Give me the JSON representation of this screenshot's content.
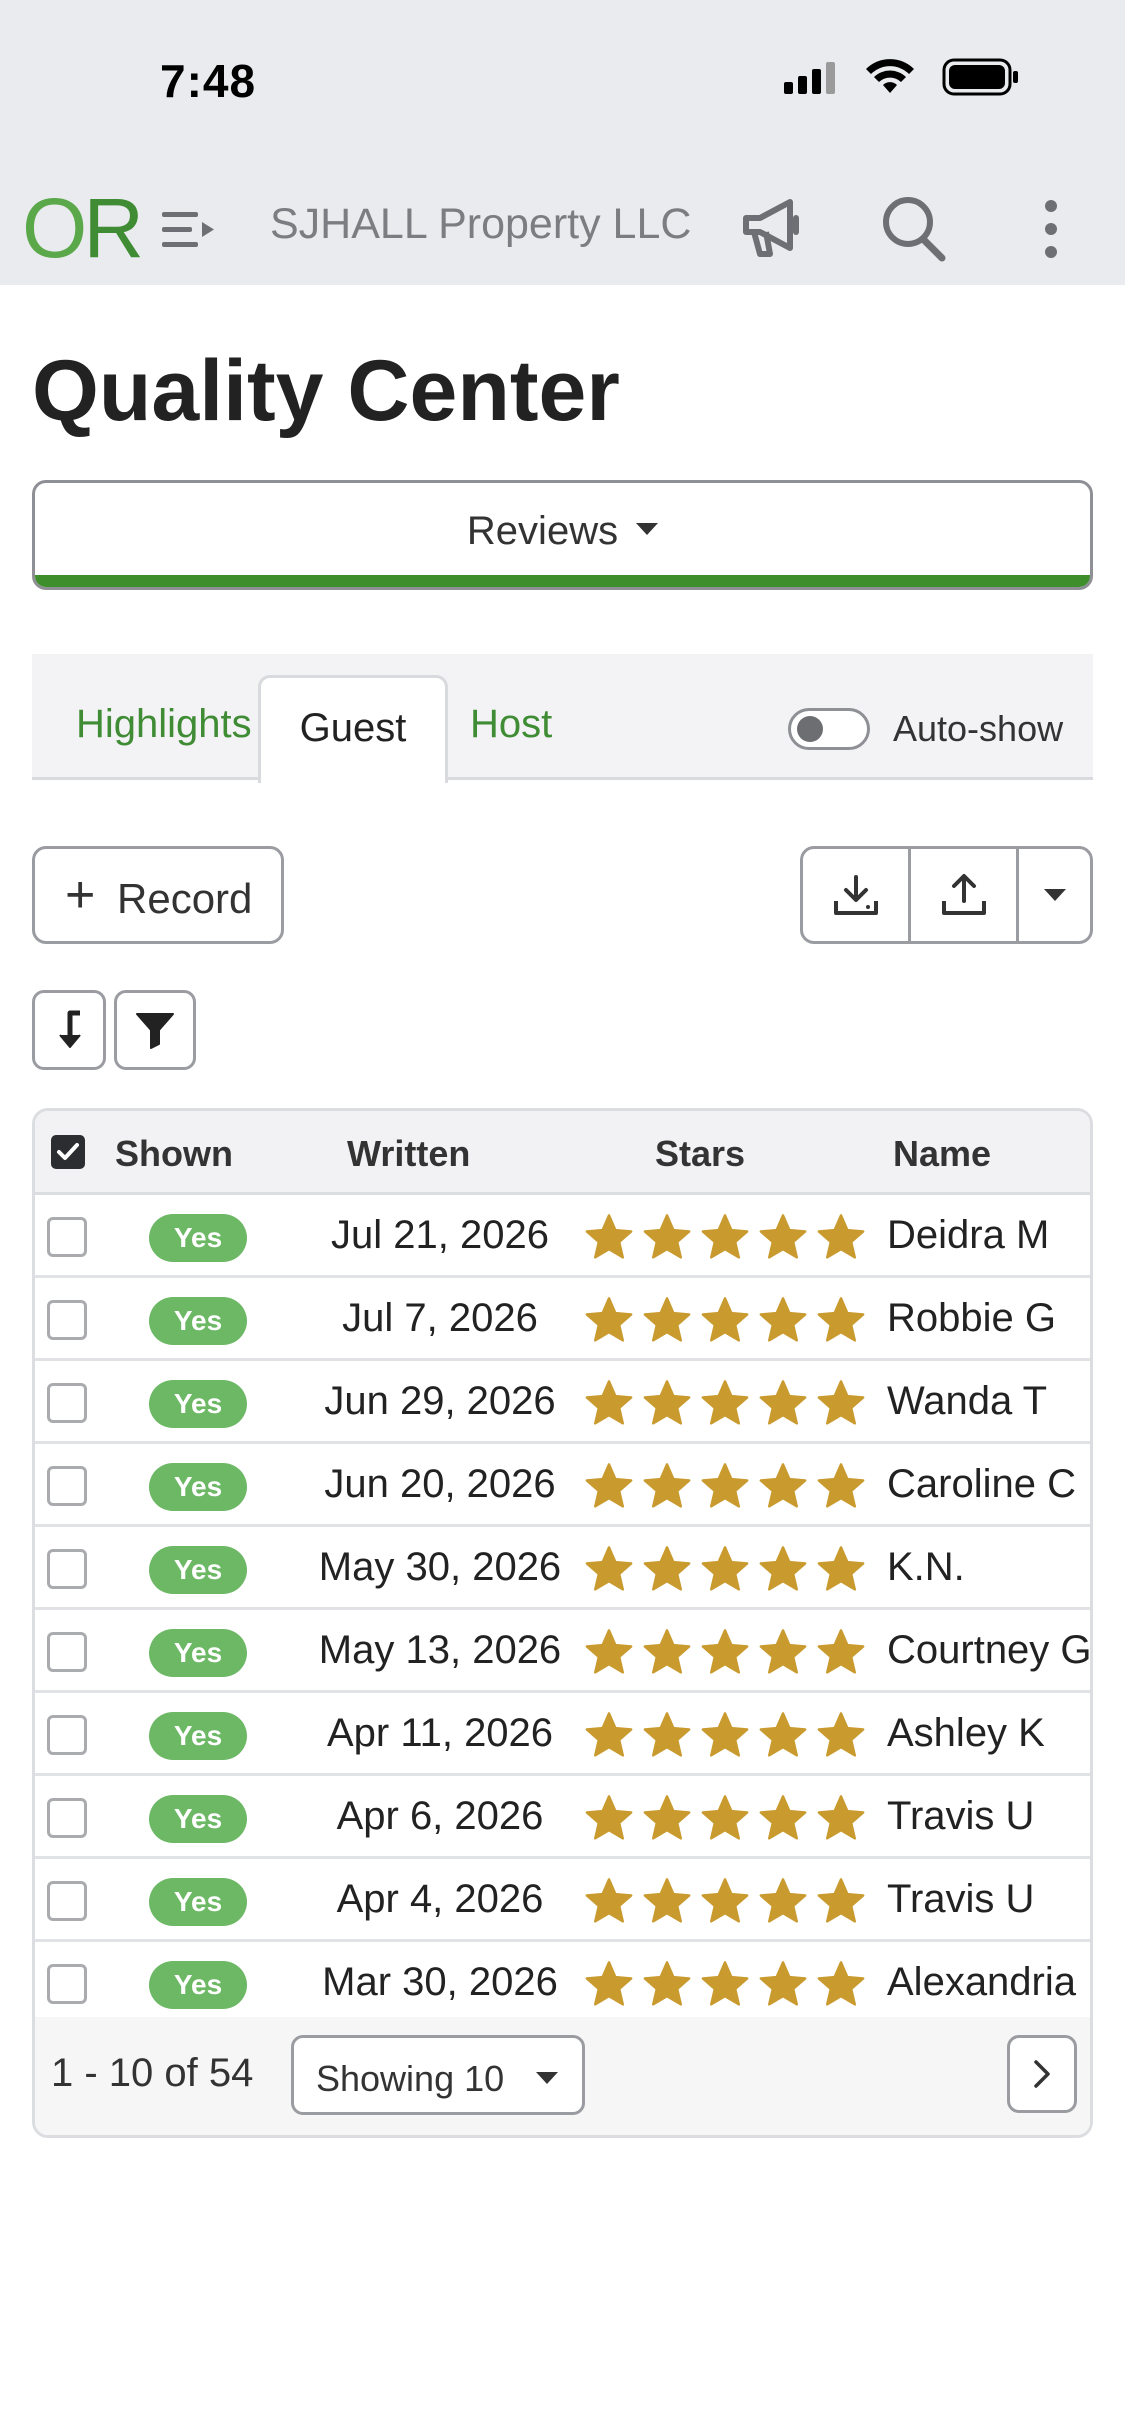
{
  "status_bar": {
    "time": "7:48"
  },
  "app_bar": {
    "logo_left": "O",
    "logo_right": "R",
    "company": "SJHALL Property LLC",
    "icons": [
      "menu-expand-icon",
      "megaphone-icon",
      "search-icon",
      "more-vertical-icon"
    ]
  },
  "page": {
    "title": "Quality Center"
  },
  "section_select": {
    "label": "Reviews",
    "accent": "#3e8e2c"
  },
  "tabs": [
    {
      "label": "Highlights",
      "active": false
    },
    {
      "label": "Guest",
      "active": true
    },
    {
      "label": "Host",
      "active": false
    }
  ],
  "auto_show": {
    "label": "Auto-show",
    "on": false
  },
  "toolbar": {
    "record_label": "Record",
    "icons": [
      "download-icon",
      "upload-icon",
      "caret-down-icon",
      "sort-icon",
      "filter-icon"
    ]
  },
  "table": {
    "columns": [
      "Shown",
      "Written",
      "Stars",
      "Name"
    ],
    "rows": [
      {
        "shown": "Yes",
        "written": "Jul 21, 2026",
        "stars": 5,
        "name": "Deidra M"
      },
      {
        "shown": "Yes",
        "written": "Jul 7, 2026",
        "stars": 5,
        "name": "Robbie G"
      },
      {
        "shown": "Yes",
        "written": "Jun 29, 2026",
        "stars": 5,
        "name": "Wanda T"
      },
      {
        "shown": "Yes",
        "written": "Jun 20, 2026",
        "stars": 5,
        "name": "Caroline C"
      },
      {
        "shown": "Yes",
        "written": "May 30, 2026",
        "stars": 5,
        "name": "K.N."
      },
      {
        "shown": "Yes",
        "written": "May 13, 2026",
        "stars": 5,
        "name": "Courtney G"
      },
      {
        "shown": "Yes",
        "written": "Apr 11, 2026",
        "stars": 5,
        "name": "Ashley K"
      },
      {
        "shown": "Yes",
        "written": "Apr 6, 2026",
        "stars": 5,
        "name": "Travis U"
      },
      {
        "shown": "Yes",
        "written": "Apr 4, 2026",
        "stars": 5,
        "name": "Travis U"
      },
      {
        "shown": "Yes",
        "written": "Mar 30, 2026",
        "stars": 5,
        "name": "Alexandria"
      }
    ],
    "star_color": "#c99a2e",
    "badge_color": "#6cb865"
  },
  "pagination": {
    "range": "1 - 10 of 54",
    "page_size_label": "Showing 10"
  }
}
